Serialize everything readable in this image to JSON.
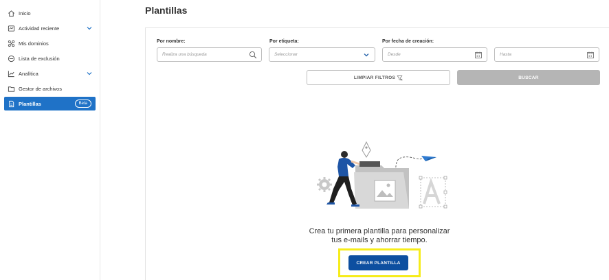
{
  "sidebar": {
    "items": [
      {
        "label": "Inicio",
        "icon": "home-icon"
      },
      {
        "label": "Actividad reciente",
        "icon": "activity-icon",
        "expandable": true
      },
      {
        "label": "Mis dominios",
        "icon": "domains-icon"
      },
      {
        "label": "Lista de exclusión",
        "icon": "block-icon"
      },
      {
        "label": "Analítica",
        "icon": "chart-icon",
        "expandable": true
      },
      {
        "label": "Gestor de archivos",
        "icon": "folder-icon"
      },
      {
        "label": "Plantillas",
        "icon": "template-icon",
        "active": true,
        "badge": "Beta"
      }
    ]
  },
  "page": {
    "title": "Plantillas"
  },
  "filters": {
    "name_label": "Por nombre:",
    "name_placeholder": "Realiza una búsqueda",
    "tag_label": "Por etiqueta:",
    "tag_placeholder": "Seleccionar",
    "date_label": "Por fecha de creación:",
    "from_placeholder": "Desde",
    "to_placeholder": "Hasta",
    "clear_label": "LIMPIAR FILTROS",
    "search_label": "BUSCAR"
  },
  "empty_state": {
    "message_line1": "Crea tu primera plantilla para personalizar",
    "message_line2": "tus e-mails y ahorrar tiempo.",
    "create_label": "CREAR PLANTILLA"
  },
  "colors": {
    "accent": "#1f72c7",
    "primary_button": "#0d4fa0",
    "disabled_button": "#b5b5b5",
    "highlight": "#f6ec1a"
  }
}
